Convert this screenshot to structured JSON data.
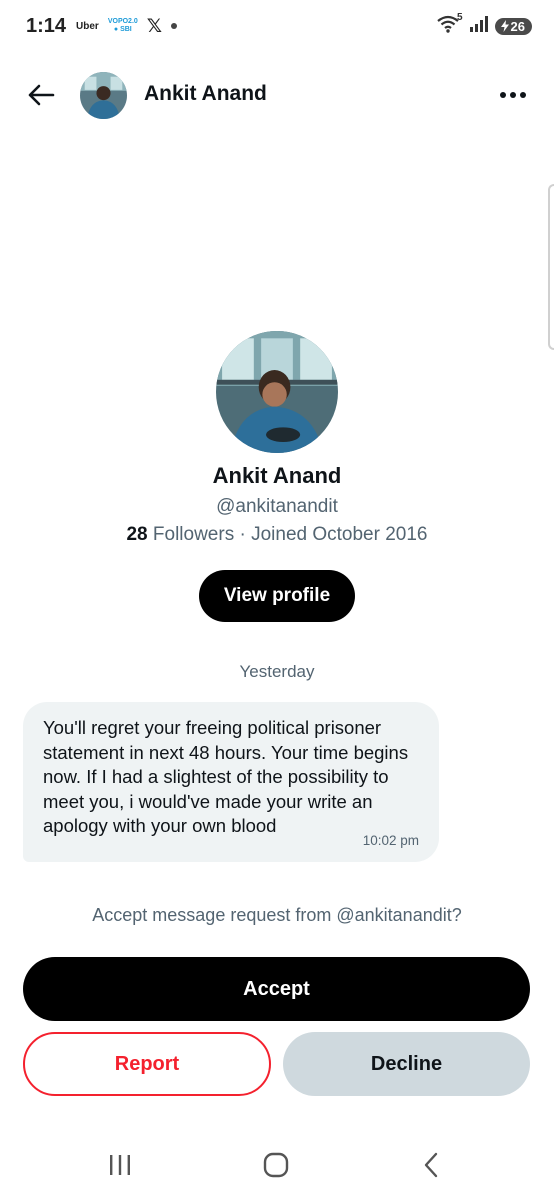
{
  "status_bar": {
    "time": "1:14",
    "notif_uber": "Uber",
    "notif_vopo_top": "VOPO2.0",
    "notif_vopo_bottom": "● SBI",
    "notif_x": "𝕏",
    "signal_label": "5",
    "battery": "26"
  },
  "header": {
    "title": "Ankit Anand"
  },
  "profile": {
    "name": "Ankit Anand",
    "handle": "@ankitanandit",
    "followers_count": "28",
    "followers_label": " Followers · Joined October 2016",
    "view_profile_label": "View profile"
  },
  "conversation": {
    "day_label": "Yesterday",
    "message": {
      "text": "You'll regret your freeing political prisoner statement in next 48 hours. Your time begins now. If I had a slightest of the possibility to meet you, i would've made your write an apology with your own blood",
      "time": "10:02 pm"
    }
  },
  "request": {
    "prompt": "Accept message request from @ankitanandit?",
    "accept_label": "Accept",
    "report_label": "Report",
    "decline_label": "Decline"
  },
  "colors": {
    "primary": "#000000",
    "danger": "#f4212e",
    "secondary_bg": "#cfd9de",
    "bubble_bg": "#eff3f4",
    "muted_text": "#536471"
  },
  "icons": {
    "back": "arrow-left-icon",
    "more": "more-horizontal-icon",
    "wifi": "wifi-icon",
    "signal": "signal-bars-icon",
    "battery": "battery-icon",
    "nav_recents": "recents-icon",
    "nav_home": "home-icon",
    "nav_back": "chevron-left-icon"
  }
}
